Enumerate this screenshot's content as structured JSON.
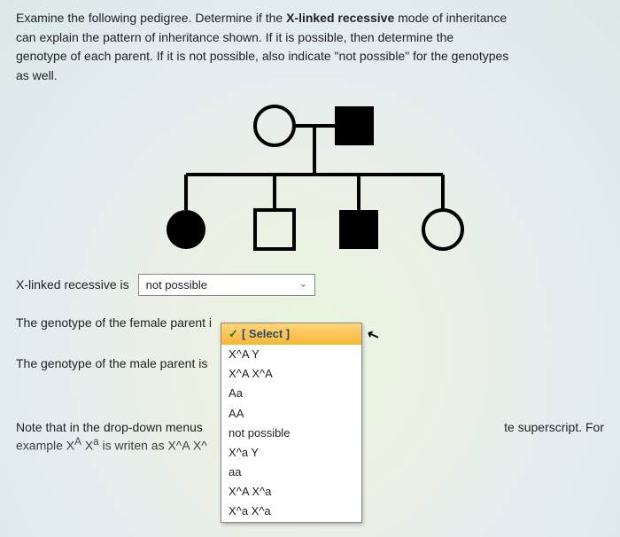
{
  "instructions": {
    "line1a": "Examine the following pedigree. Determine if the ",
    "bold1": "X-linked recessive",
    "line1b": " mode of inheritance",
    "line2": "can explain the pattern of inheritance shown. If it is possible, then determine the",
    "line3": "genotype of each parent. If it is not possible, also indicate \"not possible\" for the genotypes",
    "line4": "as well."
  },
  "q1": {
    "label": "X-linked recessive is",
    "value": "not possible"
  },
  "q2": {
    "label": "The genotype of the female parent i"
  },
  "q3": {
    "label": "The genotype of the male parent is"
  },
  "dropdown": {
    "header": "[ Select ]",
    "options": [
      "X^A Y",
      "X^A X^A",
      "Aa",
      "AA",
      "not possible",
      "X^a Y",
      "aa",
      "X^A X^a",
      "X^a X^a"
    ]
  },
  "note": {
    "left1": "Note that in the drop-down menus",
    "right": "te superscript. For",
    "left2": "example X",
    "sup": "A",
    "left2b": " X",
    "sup2": "a",
    "left2c": " is writen as X^A X^"
  }
}
